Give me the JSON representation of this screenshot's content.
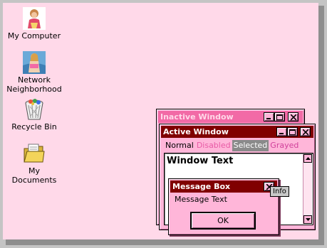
{
  "desktop": {
    "icons": [
      {
        "label": "My Computer",
        "icon": "my-computer-icon"
      },
      {
        "label_line1": "Network",
        "label_line2": "Neighborhood",
        "icon": "network-neighborhood-icon"
      },
      {
        "label": "Recycle Bin",
        "icon": "recycle-bin-icon"
      },
      {
        "label": "My Documents",
        "icon": "my-documents-icon"
      }
    ]
  },
  "colors": {
    "desktop": "#ffd9e9",
    "window_face": "#ffb6d9",
    "active_title": "#800000",
    "inactive_title": "#f26aa6"
  },
  "inactive_window": {
    "title": "Inactive Window"
  },
  "active_window": {
    "title": "Active Window",
    "menu": {
      "normal": "Normal",
      "disabled": "Disabled",
      "selected": "Selected",
      "grayed": "Grayed"
    },
    "window_text": "Window Text"
  },
  "message_box": {
    "title": "Message Box",
    "text": "Message Text",
    "ok_label": "OK",
    "tooltip": "Info"
  }
}
